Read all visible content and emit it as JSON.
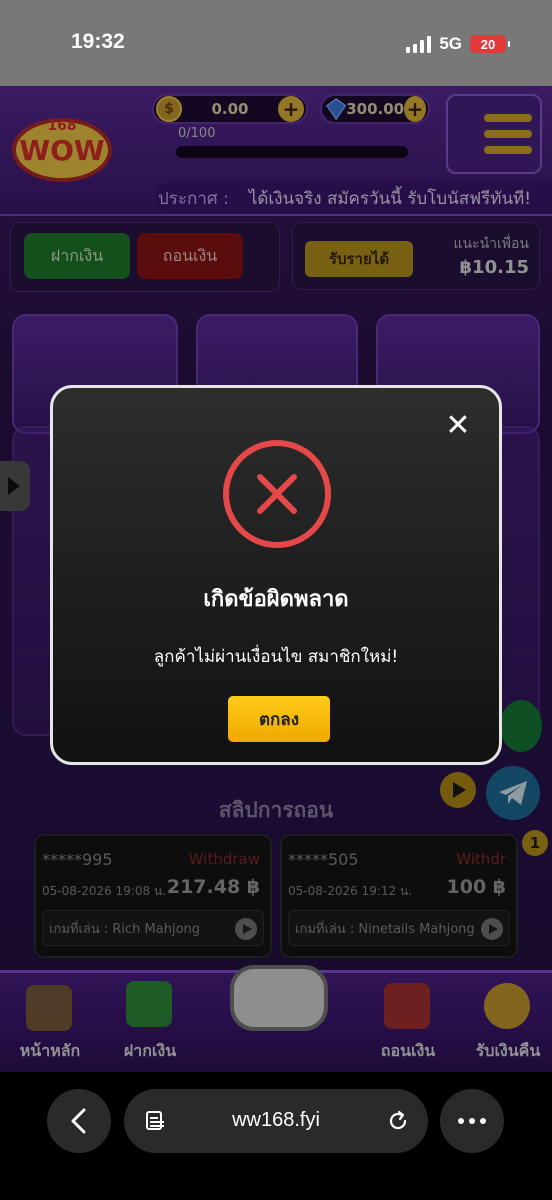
{
  "status_bar": {
    "time": "19:32",
    "network": "5G",
    "battery": "20"
  },
  "header": {
    "logo_text": "168 WOW",
    "balance": "0.00",
    "gems": "300.00",
    "level_progress": "0/100",
    "menu_icon": "hamburger-icon",
    "announcement_label": "ประกาศ :",
    "announcement_text": "ได้เงินจริง สมัครวันนี้ รับโบนัสฟรีทันที!"
  },
  "wallet": {
    "deposit_label": "ฝากเงิน",
    "withdraw_label": "ถอนเงิน"
  },
  "referral": {
    "earn_label": "รับรายได้",
    "title": "แนะนำเพื่อน",
    "amount": "฿10.15"
  },
  "withdraw_slips": {
    "title": "สลิปการถอน",
    "items": [
      {
        "account": "*****995",
        "type": "Withdraw",
        "datetime": "05-08-2026 19:08 น.",
        "amount": "217.48 ฿",
        "game": "เกมที่เล่น : Rich Mahjong"
      },
      {
        "account": "*****505",
        "type": "Withdr",
        "datetime": "05-08-2026 19:12 น.",
        "amount": "100 ฿",
        "game": "เกมที่เล่น : Ninetails Mahjong"
      }
    ]
  },
  "badge_count": "1",
  "bottom_nav": [
    {
      "label": "หน้าหลัก",
      "icon": "house-icon"
    },
    {
      "label": "ฝากเงิน",
      "icon": "deposit-icon"
    },
    {
      "label": "ถอนเงิน",
      "icon": "withdraw-icon"
    },
    {
      "label": "รับเงินคืน",
      "icon": "cashback-icon"
    }
  ],
  "modal": {
    "title": "เกิดข้อผิดพลาด",
    "message": "ลูกค้าไม่ผ่านเงื่อนไข สมาชิกใหม่!",
    "ok_label": "ตกลง",
    "error_color": "#e54848",
    "close_icon": "close-icon"
  },
  "browser": {
    "url": "ww168.fyi"
  }
}
